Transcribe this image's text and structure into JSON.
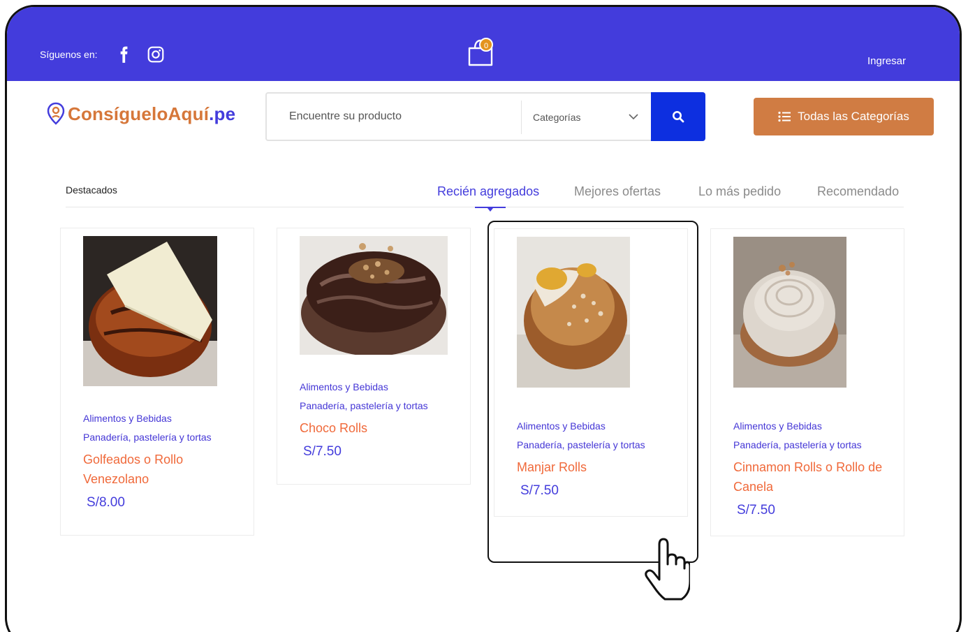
{
  "header": {
    "follow_label": "Síguenos en:",
    "cart_count": "0",
    "login_label": "Ingresar"
  },
  "logo": {
    "part1": "ConsígueloAquí",
    "part2": ".pe"
  },
  "search": {
    "placeholder": "Encuentre su producto",
    "category_label": "Categorías"
  },
  "all_categories_label": "Todas las Categorías",
  "section": {
    "title": "Destacados",
    "tabs": [
      "Recién agregados",
      "Mejores ofertas",
      "Lo más pedido",
      "Recomendado"
    ],
    "active_tab": "Recién agregados"
  },
  "products": [
    {
      "category": "Alimentos y Bebidas",
      "subcategory": "Panadería, pastelería y tortas",
      "name": "Golfeados o Rollo Venezolano",
      "price": "S/8.00"
    },
    {
      "category": "Alimentos y Bebidas",
      "subcategory": "Panadería, pastelería y tortas",
      "name": "Choco Rolls",
      "price": "S/7.50"
    },
    {
      "category": "Alimentos y Bebidas",
      "subcategory": "Panadería, pastelería y tortas",
      "name": "Manjar Rolls",
      "price": "S/7.50"
    },
    {
      "category": "Alimentos y Bebidas",
      "subcategory": "Panadería, pastelería y tortas",
      "name": "Cinnamon Rolls o Rollo de Canela",
      "price": "S/7.50"
    }
  ],
  "colors": {
    "brand_purple": "#433cdc",
    "accent_orange": "#d07c43",
    "product_name": "#f0693a",
    "search_blue": "#0d2fe0"
  }
}
